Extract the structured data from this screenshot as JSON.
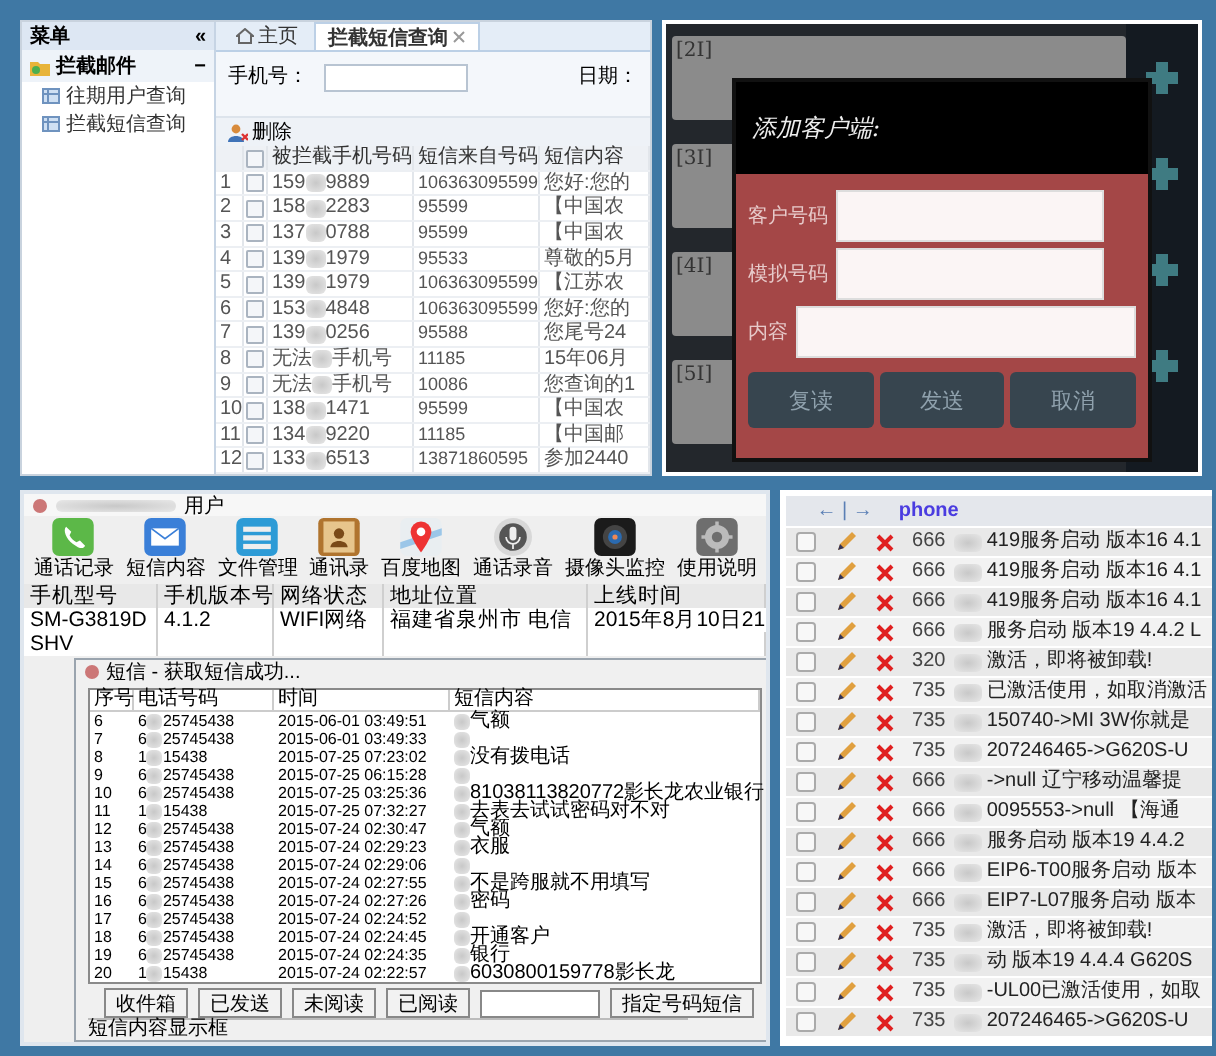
{
  "admin_panel": {
    "sidebar": {
      "title": "菜单",
      "collapse": "«",
      "group": {
        "label": "拦截邮件",
        "toggle": "−",
        "expanded": true,
        "items": [
          {
            "label": "往期用户查询",
            "selected": false
          },
          {
            "label": "拦截短信查询",
            "selected": false
          }
        ]
      }
    },
    "tabs": [
      {
        "label": "主页",
        "kind": "home",
        "selected": false
      },
      {
        "label": "拦截短信查询",
        "kind": "closable",
        "selected": true
      }
    ],
    "filters": [
      {
        "label": "手机号：",
        "kind": "field"
      },
      {
        "label": "日期：",
        "kind": "label"
      }
    ],
    "toolbar": [
      {
        "label": "删除"
      }
    ],
    "table": {
      "columns": [
        "被拦截手机号码",
        "短信来自号码",
        "短信内容"
      ],
      "header_checked": false,
      "rows": [
        {
          "index": "1",
          "checked": false,
          "phone": {
            "start": "159",
            "end": "9889"
          },
          "from": "106363095599",
          "content": "您好:您的"
        },
        {
          "index": "2",
          "checked": false,
          "phone": {
            "start": "158",
            "end": "2283"
          },
          "from": "95599",
          "content": "【中国农"
        },
        {
          "index": "3",
          "checked": false,
          "phone": {
            "start": "137",
            "end": "0788"
          },
          "from": "95599",
          "content": "【中国农"
        },
        {
          "index": "4",
          "checked": false,
          "phone": {
            "start": "139",
            "end": "1979"
          },
          "from": "95533",
          "content": "尊敬的5月"
        },
        {
          "index": "5",
          "checked": false,
          "phone": {
            "start": "139",
            "end": "1979"
          },
          "from": "106363095599",
          "content": "【江苏农"
        },
        {
          "index": "6",
          "checked": false,
          "phone": {
            "start": "153",
            "end": "4848"
          },
          "from": "106363095599",
          "content": "您好:您的"
        },
        {
          "index": "7",
          "checked": false,
          "phone": {
            "start": "139",
            "end": "0256"
          },
          "from": "95588",
          "content": "您尾号24"
        },
        {
          "index": "8",
          "checked": false,
          "phone": {
            "start": "无法",
            "end": "手机号"
          },
          "from": "11185",
          "content": "15年06月"
        },
        {
          "index": "9",
          "checked": false,
          "phone": {
            "start": "无法",
            "end": "手机号"
          },
          "from": "10086",
          "content": "您查询的1"
        },
        {
          "index": "10",
          "checked": false,
          "phone": {
            "start": "138",
            "end": "1471"
          },
          "from": "95599",
          "content": "【中国农"
        },
        {
          "index": "11",
          "checked": false,
          "phone": {
            "start": "134",
            "end": "9220"
          },
          "from": "11185",
          "content": "【中国邮"
        },
        {
          "index": "12",
          "checked": false,
          "phone": {
            "start": "133",
            "end": "6513"
          },
          "from": "13871860595",
          "content": "参加2440"
        }
      ]
    }
  },
  "client_dialog": {
    "cards": [
      "[2I]",
      "[3I]",
      "[4I]",
      "[5I]"
    ],
    "title": "添加客户端:",
    "fields": [
      {
        "label": "客户号码"
      },
      {
        "label": "模拟号码"
      },
      {
        "label": "内容"
      }
    ],
    "buttons": [
      "复读",
      "发送",
      "取消"
    ]
  },
  "monitor_window": {
    "title": "用户",
    "tools": [
      {
        "label": "通话记录",
        "kind": "phone"
      },
      {
        "label": "短信内容",
        "kind": "mail"
      },
      {
        "label": "文件管理",
        "kind": "files"
      },
      {
        "label": "通讯录",
        "kind": "contacts"
      },
      {
        "label": "百度地图",
        "kind": "map"
      },
      {
        "label": "通话录音",
        "kind": "mic"
      },
      {
        "label": "摄像头监控",
        "kind": "camera"
      },
      {
        "label": "使用说明",
        "kind": "gear"
      }
    ],
    "columns": [
      "手机型号",
      "手机版本号",
      "网络状态",
      "地址位置",
      "上线时间"
    ],
    "rows": [
      {
        "cells": [
          "SM-G3819D",
          "4.1.2",
          "WIFI网络",
          "福建省泉州市 电信",
          "2015年8月10日21"
        ]
      },
      {
        "cells": [
          "SHV"
        ]
      }
    ],
    "sms_dialog": {
      "title": "短信 - 获取短信成功...",
      "columns": [
        "序号",
        "电话号码",
        "时间",
        "短信内容"
      ],
      "rows": [
        {
          "index": "6",
          "phone": {
            "start": "6",
            "end": "25745438"
          },
          "time": "2015-06-01 03:49:51",
          "content": "气额"
        },
        {
          "index": "7",
          "phone": {
            "start": "6",
            "end": "25745438"
          },
          "time": "2015-06-01 03:49:33"
        },
        {
          "index": "8",
          "phone": {
            "start": "1",
            "end": "15438"
          },
          "time": "2015-07-25 07:23:02",
          "content": "没有拨电话"
        },
        {
          "index": "9",
          "phone": {
            "start": "6",
            "end": "25745438"
          },
          "time": "2015-07-25 06:15:28"
        },
        {
          "index": "10",
          "phone": {
            "start": "6",
            "end": "25745438"
          },
          "time": "2015-07-25 03:25:36",
          "content": "81038113820772影长龙农业银行"
        },
        {
          "index": "11",
          "phone": {
            "start": "1",
            "end": "15438"
          },
          "time": "2015-07-25 07:32:27",
          "content": "去表去试试密码对不对"
        },
        {
          "index": "12",
          "phone": {
            "start": "6",
            "end": "25745438"
          },
          "time": "2015-07-24 02:30:47",
          "content": "气额"
        },
        {
          "index": "13",
          "phone": {
            "start": "6",
            "end": "25745438"
          },
          "time": "2015-07-24 02:29:23",
          "content": "衣服"
        },
        {
          "index": "14",
          "phone": {
            "start": "6",
            "end": "25745438"
          },
          "time": "2015-07-24 02:29:06"
        },
        {
          "index": "15",
          "phone": {
            "start": "6",
            "end": "25745438"
          },
          "time": "2015-07-24 02:27:55",
          "content": "不是跨服就不用填写"
        },
        {
          "index": "16",
          "phone": {
            "start": "6",
            "end": "25745438"
          },
          "time": "2015-07-24 02:27:26",
          "content": "密码"
        },
        {
          "index": "17",
          "phone": {
            "start": "6",
            "end": "25745438"
          },
          "time": "2015-07-24 02:24:52"
        },
        {
          "index": "18",
          "phone": {
            "start": "6",
            "end": "25745438"
          },
          "time": "2015-07-24 02:24:45",
          "content": "开通客户"
        },
        {
          "index": "19",
          "phone": {
            "start": "6",
            "end": "25745438"
          },
          "time": "2015-07-24 02:24:35",
          "content": "银行"
        },
        {
          "index": "20",
          "phone": {
            "start": "1",
            "end": "15438"
          },
          "time": "2015-07-24 02:22:57",
          "content": "6030800159778影长龙"
        }
      ],
      "controls": [
        {
          "kind": "button",
          "label": "收件箱"
        },
        {
          "kind": "button",
          "label": "已发送"
        },
        {
          "kind": "button",
          "label": "未阅读"
        },
        {
          "kind": "button",
          "label": "已阅读"
        },
        {
          "kind": "field"
        },
        {
          "kind": "button",
          "label": "指定号码短信"
        }
      ],
      "footer": "短信内容显示框"
    }
  },
  "records_table": {
    "columns": [
      "← | →",
      "phone"
    ],
    "rows": [
      {
        "checked": false,
        "phone": "666",
        "message": "419服务启动 版本16 4.1"
      },
      {
        "checked": false,
        "phone": "666",
        "message": "419服务启动 版本16 4.1"
      },
      {
        "checked": false,
        "phone": "666",
        "message": "419服务启动 版本16 4.1"
      },
      {
        "checked": false,
        "phone": "666",
        "message": "服务启动 版本19 4.4.2 L"
      },
      {
        "checked": false,
        "phone": "320",
        "message": "激活，即将被卸载!"
      },
      {
        "checked": false,
        "phone": "735",
        "message": "已激活使用，如取消激活"
      },
      {
        "checked": false,
        "phone": "735",
        "message": "150740->MI 3W你就是"
      },
      {
        "checked": false,
        "phone": "735",
        "message": "207246465->G620S-U"
      },
      {
        "checked": false,
        "phone": "666",
        "message": "->null 辽宁移动温馨提"
      },
      {
        "checked": false,
        "phone": "666",
        "message": "0095553->null 【海通"
      },
      {
        "checked": false,
        "phone": "666",
        "message": "服务启动 版本19 4.4.2"
      },
      {
        "checked": false,
        "phone": "666",
        "message": "EIP6-T00服务启动 版本"
      },
      {
        "checked": false,
        "phone": "666",
        "message": "EIP7-L07服务启动 版本"
      },
      {
        "checked": false,
        "phone": "735",
        "message": "激活，即将被卸载!"
      },
      {
        "checked": false,
        "phone": "735",
        "message": "动 版本19 4.4.4 G620S"
      },
      {
        "checked": false,
        "phone": "735",
        "message": "-UL00已激活使用，如取"
      },
      {
        "checked": false,
        "phone": "735",
        "message": "207246465->G620S-U"
      }
    ]
  }
}
